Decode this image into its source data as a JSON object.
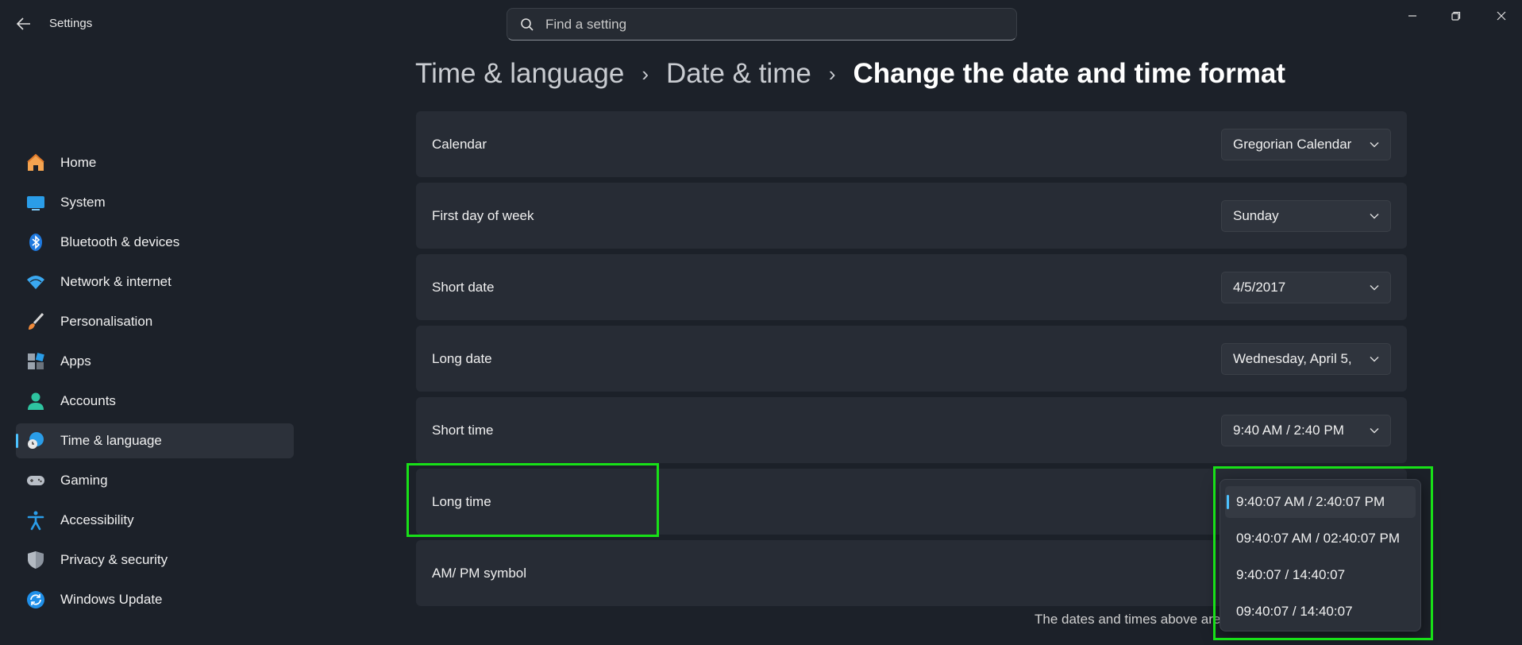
{
  "window": {
    "title": "Settings",
    "search_placeholder": "Find a setting"
  },
  "sidebar": {
    "items": [
      {
        "label": "Home",
        "icon": "home-icon"
      },
      {
        "label": "System",
        "icon": "system-icon"
      },
      {
        "label": "Bluetooth & devices",
        "icon": "bluetooth-icon"
      },
      {
        "label": "Network & internet",
        "icon": "wifi-icon"
      },
      {
        "label": "Personalisation",
        "icon": "brush-icon"
      },
      {
        "label": "Apps",
        "icon": "apps-icon"
      },
      {
        "label": "Accounts",
        "icon": "account-icon"
      },
      {
        "label": "Time & language",
        "icon": "globe-clock-icon",
        "active": true
      },
      {
        "label": "Gaming",
        "icon": "gamepad-icon"
      },
      {
        "label": "Accessibility",
        "icon": "accessibility-icon"
      },
      {
        "label": "Privacy & security",
        "icon": "shield-icon"
      },
      {
        "label": "Windows Update",
        "icon": "update-icon"
      }
    ]
  },
  "breadcrumb": {
    "level1": "Time & language",
    "level2": "Date & time",
    "current": "Change the date and time format"
  },
  "settings": [
    {
      "label": "Calendar",
      "value": "Gregorian Calendar"
    },
    {
      "label": "First day of week",
      "value": "Sunday"
    },
    {
      "label": "Short date",
      "value": "4/5/2017"
    },
    {
      "label": "Long date",
      "value": "Wednesday, April 5,"
    },
    {
      "label": "Short time",
      "value": "9:40 AM / 2:40 PM"
    },
    {
      "label": "Long time",
      "value": ""
    },
    {
      "label": "AM/ PM symbol",
      "value": ""
    }
  ],
  "long_time_options": [
    "9:40:07 AM / 2:40:07 PM",
    "09:40:07 AM / 02:40:07 PM",
    "9:40:07 / 14:40:07",
    "09:40:07 / 14:40:07"
  ],
  "footer_text": "The dates and times above are",
  "colors": {
    "accent": "#4cc2ff",
    "highlight": "#18e018",
    "background": "#1c2129"
  }
}
